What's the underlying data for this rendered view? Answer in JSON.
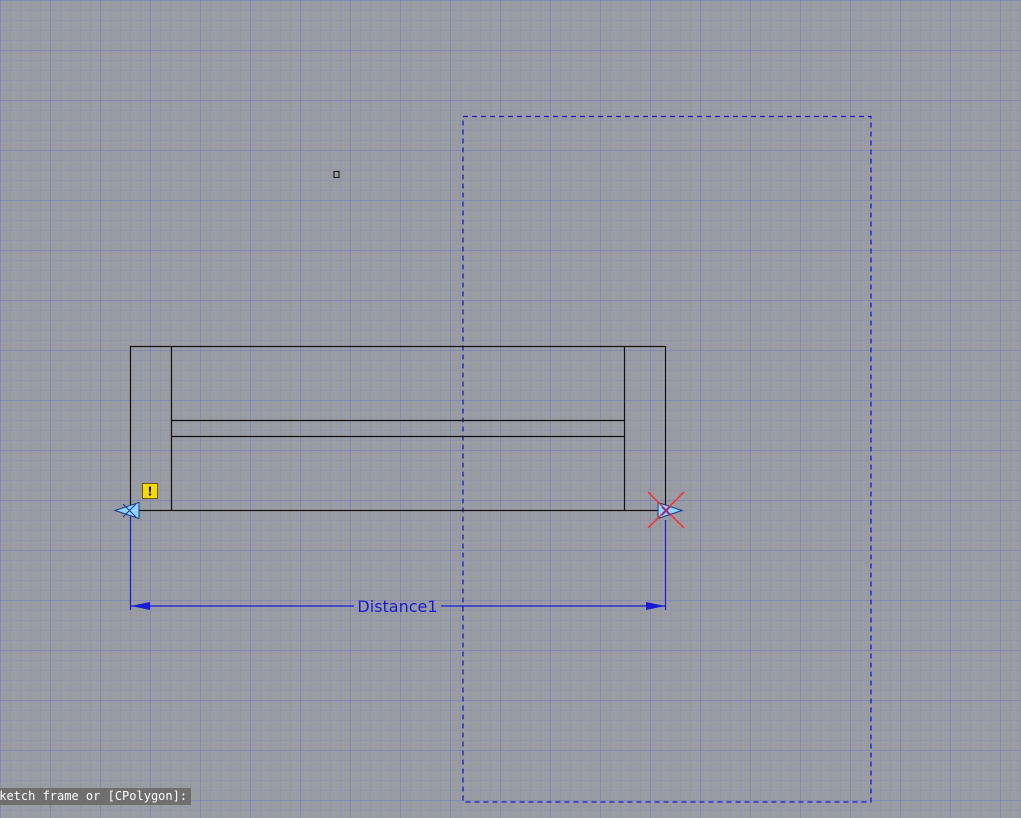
{
  "viewport": {
    "background": "#9a9ca3",
    "grid_color": "#7880be"
  },
  "sketch": {
    "dimension_label": "Distance1",
    "dimension_color": "#1a1ad6",
    "constraint_warning_glyph": "!",
    "warning_color": "#f5d90a",
    "handle_fill": "#8fd3ff",
    "invalid_marker_color": "#ff2a2a",
    "icons": [
      "warning-icon",
      "left-arrow-handle-icon",
      "right-arrow-handle-icon",
      "x-marker-icon",
      "cursor-pickbox-icon"
    ]
  },
  "command_line": {
    "prompt": "Sketch frame or [CPolygon]:"
  }
}
